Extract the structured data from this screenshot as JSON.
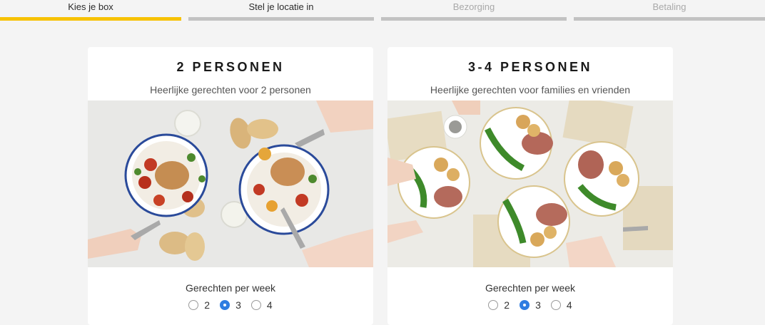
{
  "steps": [
    {
      "label": "Kies je box",
      "state": "active"
    },
    {
      "label": "Stel je locatie in",
      "state": "current"
    },
    {
      "label": "Bezorging",
      "state": "future"
    },
    {
      "label": "Betaling",
      "state": "future"
    }
  ],
  "plans": [
    {
      "title": "2 PERSONEN",
      "subtitle": "Heerlijke gerechten voor 2 personen",
      "photo_name": "two-person-meal-photo",
      "freq_label": "Gerechten per week",
      "options": [
        "2",
        "3",
        "4"
      ],
      "selected": "3"
    },
    {
      "title": "3-4 PERSONEN",
      "subtitle": "Heerlijke gerechten voor families en vrienden",
      "photo_name": "family-meal-photo",
      "freq_label": "Gerechten per week",
      "options": [
        "2",
        "3",
        "4"
      ],
      "selected": "3"
    }
  ],
  "colors": {
    "accent": "#f7c203",
    "radio_selected": "#2f7de1",
    "inactive_bar": "#c2c2c2"
  }
}
